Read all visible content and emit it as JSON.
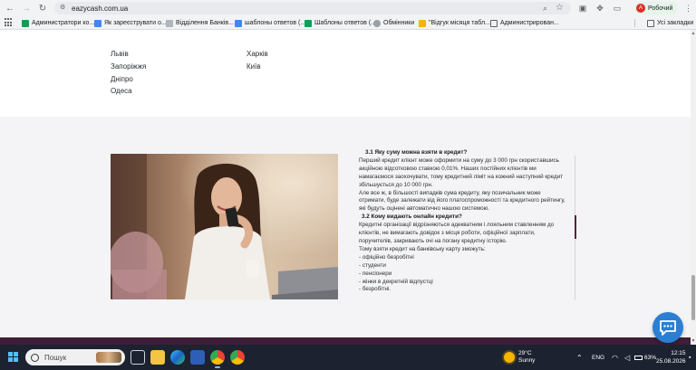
{
  "browser": {
    "url": "eazycash.com.ua",
    "profile_initial": "А",
    "profile_name": "Робочий",
    "all_bookmarks_label": "Усі закладки",
    "bookmarks": [
      {
        "label": "Администратори ко...",
        "icon": "sheet-icon"
      },
      {
        "label": "Як зареєструвати о...",
        "icon": "doc-icon"
      },
      {
        "label": "Відділення Банків...",
        "icon": "bank-icon"
      },
      {
        "label": "шаблоны ответов (...",
        "icon": "doc-icon"
      },
      {
        "label": "Шаблоны ответов (...",
        "icon": "sheet-icon"
      },
      {
        "label": "Обмінники",
        "icon": "globe-icon"
      },
      {
        "label": "\"Відгук місяця табл...",
        "icon": "vote-icon"
      },
      {
        "label": "Администрирован...",
        "icon": "folder-icon"
      }
    ]
  },
  "cities": {
    "col1": [
      "Львів",
      "Запоріжжя",
      "Дніпро",
      "Одеса"
    ],
    "col2": [
      "Харків",
      "Київ"
    ]
  },
  "faq": {
    "q1_title": "3.1 Яку суму можна взяти в кредит?",
    "q1_answer_1": "Перший кредит клієнт може оформити на суму до 3 000 грн скориставшись акційною відсотковою ставкою 0,01%. Наших постійних клієнтів ми намагаємося заохочувати, тому кредитний ліміт на кожний наступний кредит збільшується до 10 000 грн.",
    "q1_answer_2": "Але все ж, в більшості випадків сума кредиту, яку позичальник може отримати, буде залежати від його платоспроможності та кредитного рейтингу, які будуть оцінені автоматично нашою системою.",
    "q2_title": "3.2 Кому видають онлайн кредити?",
    "q2_answer_1": "Кредитні організації відрізняються адекватним і лояльним ставленням до клієнтів, не вимагають довідок з місця роботи, офіційної зарплати, поручителів, закривають очі на погану кредитну історію.",
    "q2_answer_2": "Тому взяти кредит на банківську карту зможуть:",
    "q2_list": [
      "- офіційно безробітні",
      "- студенти",
      "- пенсіонери",
      "- жінки в декретній відпустці",
      "- безробітні."
    ]
  },
  "taskbar": {
    "search_placeholder": "Пошук",
    "weather_temp": "29°C",
    "weather_desc": "Sunny",
    "language": "ENG",
    "battery": "63%",
    "time": "12:15",
    "date": "25.08.2026"
  },
  "colors": {
    "accent_maroon": "#5a2040",
    "footer": "#3e1e38",
    "chat_button": "#2a7fd4",
    "section_bg": "#f4f4f6"
  }
}
